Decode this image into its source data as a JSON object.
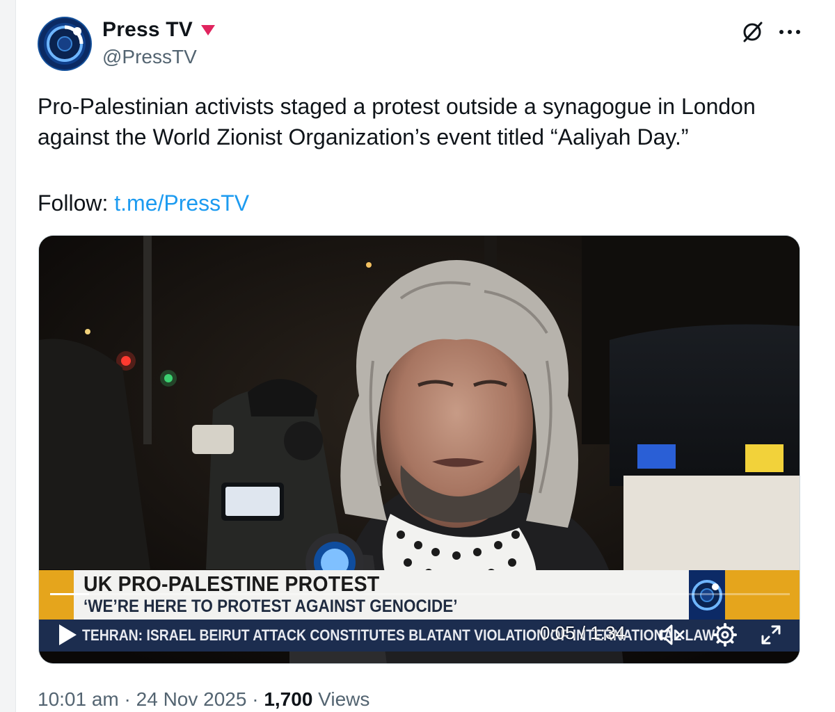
{
  "author": {
    "name": "Press TV",
    "handle": "@PressTV"
  },
  "tweet": {
    "text": "Pro-Palestinian activists staged a protest outside a synagogue in London against the World Zionist Organization’s event titled “Aaliyah Day.”",
    "follow_prefix": "Follow: ",
    "follow_link": "t.me/PressTV"
  },
  "video": {
    "headline": "UK PRO-PALESTINE PROTEST",
    "subheadline": "‘WE’RE HERE TO PROTEST AGAINST GENOCIDE’",
    "ticker": "TEHRAN: ISRAEL BEIRUT ATTACK CONSTITUTES BLATANT VIOLATION OF INTERNATIONAL LAW",
    "time": "0:05 / 1:34",
    "progress": 0.053
  },
  "meta": {
    "time": "10:01 am",
    "separator": " · ",
    "date": "24 Nov 2025",
    "views_count": "1,700",
    "views_label": " Views"
  },
  "colors": {
    "link": "#1d9bf0",
    "secondary_text": "#536471",
    "badge": "#e0245e",
    "lower_third_orange": "#e5a51c",
    "ticker_navy": "#1c2d4f"
  },
  "icons": {
    "badge": "triangle-down-icon",
    "grok": "grok-icon",
    "more": "more-icon",
    "play": "play-icon",
    "mute": "mute-icon",
    "settings": "gear-icon",
    "fullscreen": "fullscreen-icon"
  }
}
